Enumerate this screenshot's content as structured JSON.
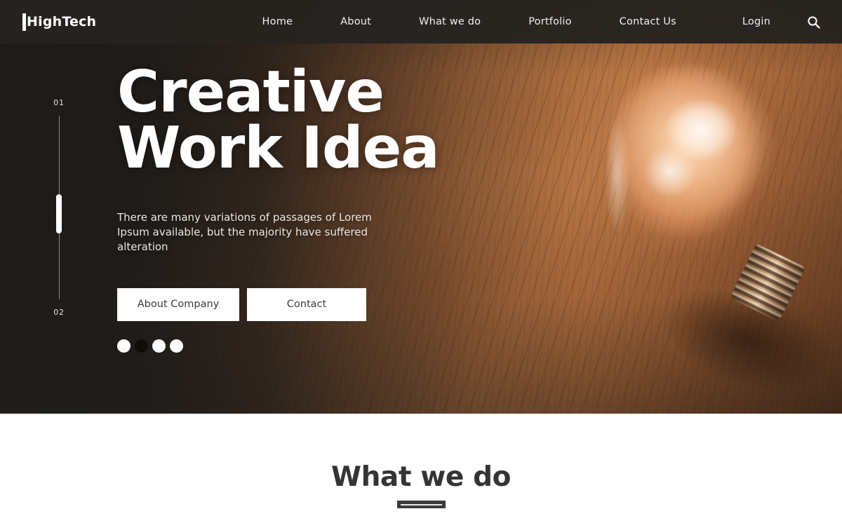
{
  "header": {
    "logo": {
      "text": "HighTech",
      "icon": "vertical-bar-icon"
    },
    "nav": [
      {
        "label": "Home"
      },
      {
        "label": "About"
      },
      {
        "label": "What we do"
      },
      {
        "label": "Portfolio"
      },
      {
        "label": "Contact Us"
      }
    ],
    "login_label": "Login",
    "search_icon": "search-icon",
    "background_color": "#262320",
    "text_color": "#f2efec"
  },
  "hero": {
    "title_line1": "Creative",
    "title_line2": "Work Idea",
    "description": "There are many variations of passages of Lorem Ipsum available, but the majority have suffered alteration",
    "buttons": [
      {
        "label": "About Company"
      },
      {
        "label": "Contact"
      }
    ],
    "dots": [
      {
        "active": false
      },
      {
        "active": true
      },
      {
        "active": false
      },
      {
        "active": false
      }
    ],
    "slider": {
      "top_number": "01",
      "bottom_number": "02"
    },
    "image_description": "glowing light bulb on wooden table",
    "accent_color": "#c07b47",
    "overlay_color": "#1d1b19"
  },
  "section": {
    "title": "What we do",
    "title_color": "#343434",
    "background_color": "#ffffff"
  }
}
